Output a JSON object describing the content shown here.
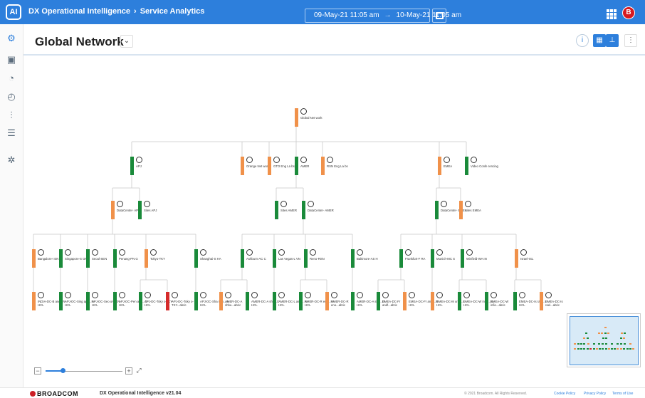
{
  "topbar": {
    "logo_text": "AI",
    "breadcrumb": [
      "DX Operational Intelligence",
      "Service Analytics"
    ],
    "breadcrumb_sep": "›",
    "time_start": "09-May-21 11:05 am",
    "time_arrow": "→",
    "time_end": "10-May-21 11:05 am",
    "user_initial": "B",
    "brand_color": "#2d7fdc"
  },
  "sidebar": {
    "icons": [
      "services-icon",
      "monitor-icon",
      "alarm-icon",
      "dashboard-icon",
      "analytics-icon",
      "report-icon",
      "settings-icon"
    ]
  },
  "header": {
    "title": "Global Network",
    "chevron": "⌄"
  },
  "status_colors": {
    "green": "#1a8a3a",
    "orange": "#f0914a",
    "red": "#d52b2b"
  },
  "tree": {
    "nodes": [
      {
        "id": "root",
        "label": "Global Net work",
        "status": "orange",
        "parent": null
      },
      {
        "id": "apj",
        "label": "APJ",
        "status": "green",
        "parent": "root"
      },
      {
        "id": "orange",
        "label": "Orange Net work",
        "status": "orange",
        "parent": "root"
      },
      {
        "id": "gto",
        "label": "GTO Eng La bs",
        "status": "orange",
        "parent": "root"
      },
      {
        "id": "amer",
        "label": "AMER",
        "status": "green",
        "parent": "root"
      },
      {
        "id": "rsn",
        "label": "RSN Eng La bs",
        "status": "orange",
        "parent": "root"
      },
      {
        "id": "emea",
        "label": "EMEA",
        "status": "orange",
        "parent": "root"
      },
      {
        "id": "video",
        "label": "Video Confe rencing",
        "status": "green",
        "parent": "root"
      },
      {
        "id": "dcapj",
        "label": "DataCenter- APJ",
        "status": "orange",
        "parent": "apj"
      },
      {
        "id": "sitesapj",
        "label": "Sites APJ",
        "status": "green",
        "parent": "apj"
      },
      {
        "id": "sitesamer",
        "label": "Sites AMER",
        "status": "green",
        "parent": "amer"
      },
      {
        "id": "dcamer",
        "label": "DataCenter- AMER",
        "status": "green",
        "parent": "amer"
      },
      {
        "id": "dcemea",
        "label": "DataCenter- EMEA",
        "status": "green",
        "parent": "emea"
      },
      {
        "id": "sitesemea",
        "label": "Sites EMEA",
        "status": "orange",
        "parent": "emea"
      },
      {
        "id": "bang",
        "label": "Bangalore-I EN",
        "status": "orange",
        "parent": "dcapj"
      },
      {
        "id": "sing",
        "label": "Singapore-S GN",
        "status": "green",
        "parent": "dcapj"
      },
      {
        "id": "seoul",
        "label": "Seoul-SEN",
        "status": "green",
        "parent": "dcapj"
      },
      {
        "id": "pen",
        "label": "Penang-PN G",
        "status": "green",
        "parent": "dcapj"
      },
      {
        "id": "tokyo",
        "label": "Tokyo-TKY",
        "status": "orange",
        "parent": "dcapj"
      },
      {
        "id": "shang",
        "label": "Shanghai-S HA",
        "status": "green",
        "parent": "dcapj"
      },
      {
        "id": "ashb",
        "label": "Ashburn-AC C",
        "status": "green",
        "parent": "dcamer"
      },
      {
        "id": "lasv",
        "label": "Las Vegas-L VN",
        "status": "green",
        "parent": "dcamer"
      },
      {
        "id": "reno",
        "label": "Reno-RSN",
        "status": "green",
        "parent": "dcamer"
      },
      {
        "id": "balt",
        "label": "Baltimore-AS H",
        "status": "green",
        "parent": "dcamer"
      },
      {
        "id": "frank",
        "label": "Frankfurt-F RA",
        "status": "green",
        "parent": "dcemea"
      },
      {
        "id": "munich",
        "label": "Munich-MC S",
        "status": "green",
        "parent": "dcemea"
      },
      {
        "id": "winn",
        "label": "Winfield-WA IN",
        "status": "green",
        "parent": "dcemea"
      },
      {
        "id": "israel",
        "label": "Israel-ISL",
        "status": "orange",
        "parent": "dcemea"
      },
      {
        "id": "l1",
        "label": "INDIA-DC-B ang...N-HCL",
        "status": "orange",
        "parent": "bang"
      },
      {
        "id": "l2",
        "label": "APJ-DC-Sing apo...N-HCL",
        "status": "green",
        "parent": "sing"
      },
      {
        "id": "l3",
        "label": "APJ-DC-Seo ul-SEN-HCL",
        "status": "green",
        "parent": "seoul"
      },
      {
        "id": "l4",
        "label": "APJ-DC-Pen ang...G-HCL",
        "status": "green",
        "parent": "pen"
      },
      {
        "id": "l5",
        "label": "APJ-DC-Toky o-TKY-HCL",
        "status": "green",
        "parent": "tokyo"
      },
      {
        "id": "l6",
        "label": "APJ-DC-Toky o-TKY...abric",
        "status": "red",
        "parent": "tokyo"
      },
      {
        "id": "l7",
        "label": "APJ-DC-Sha ngh...A-HCL",
        "status": "green",
        "parent": "shang"
      },
      {
        "id": "l8",
        "label": "AMER-DC-A shbu...abric",
        "status": "orange",
        "parent": "ashb"
      },
      {
        "id": "l9",
        "label": "AMER-DC-A shb...C-HCL",
        "status": "green",
        "parent": "ashb"
      },
      {
        "id": "l10",
        "label": "AMER-DC-L as V...N-HCL",
        "status": "green",
        "parent": "lasv"
      },
      {
        "id": "l11",
        "label": "AMER-DC-R eno...N-HCL",
        "status": "green",
        "parent": "reno"
      },
      {
        "id": "l12",
        "label": "AMER-DC-R eno...abric",
        "status": "orange",
        "parent": "reno"
      },
      {
        "id": "l13",
        "label": "AMER-DC-A shb...D-HCL",
        "status": "green",
        "parent": "balt"
      },
      {
        "id": "l14",
        "label": "EMEA-DC-Fr ankf...abric",
        "status": "green",
        "parent": "frank"
      },
      {
        "id": "l15",
        "label": "EMEA-DC-Fr ankf...R-HCL",
        "status": "orange",
        "parent": "frank"
      },
      {
        "id": "l16",
        "label": "EMEA-DC-M unic...L-HCL",
        "status": "orange",
        "parent": "munich"
      },
      {
        "id": "l17",
        "label": "EMEA-DC-W infie...N-HCL",
        "status": "green",
        "parent": "winn"
      },
      {
        "id": "l18",
        "label": "EMEA-DC-W infie...abric",
        "status": "green",
        "parent": "winn"
      },
      {
        "id": "l19",
        "label": "EMEA-DC-Is rael...L-HCL",
        "status": "green",
        "parent": "israel"
      },
      {
        "id": "l20",
        "label": "EMEA-DC-Is rael...abric",
        "status": "orange",
        "parent": "israel"
      }
    ]
  },
  "zoom": {
    "minus": "−",
    "plus": "+",
    "fit": "⤢",
    "level": 0.22
  },
  "footer": {
    "brand": "BROADCOM",
    "product": "DX Operational Intelligence v21.04",
    "copyright": "© 2021 Broadcom. All Rights Reserved.",
    "links": [
      "Cookie Policy",
      "Privacy Policy",
      "Terms of Use"
    ]
  }
}
